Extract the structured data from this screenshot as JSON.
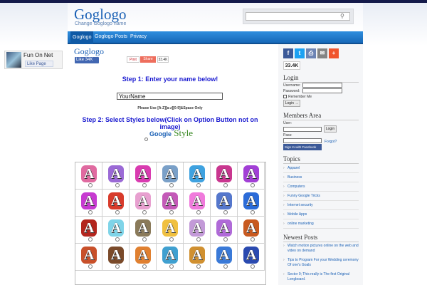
{
  "site": {
    "title": "Goglogo",
    "description": "Change Goglogo name"
  },
  "search": {
    "placeholder": ""
  },
  "nav": {
    "items": [
      "Goglogo",
      "Goglogo Posts",
      "Privacy"
    ]
  },
  "left_widget": {
    "name": "Fun On Net",
    "like_label": "Like Page"
  },
  "post": {
    "title": "Goglogo",
    "fb_like": "Like 34K",
    "pin_label": "Pinit",
    "share_label": "Share",
    "share_count": "33.4K",
    "step1": "Step 1: Enter your name below!",
    "name_value": "YourName",
    "use_note": "Please Use [A-Z][a-z][0-9]&Space Only",
    "step2": "Step 2: Select Styles below(Click on Option Button not on image)",
    "style_sample_prefix": "Google",
    "style_sample_suffix": "Style"
  },
  "style_grid": {
    "glyph": "A",
    "rows": [
      [
        "#e06aa0",
        "#9b6ad6",
        "#d93bb0",
        "#7aa0c8",
        "#3fa2e0",
        "#c9368f",
        "#a23fd6"
      ],
      [
        "#c73bd1",
        "#d83b2b",
        "#e8a0d0",
        "#c45ab8",
        "#f07adc",
        "#5577cc",
        "#2b6bd8"
      ],
      [
        "#b3261e",
        "#7fd4e8",
        "#8a7a5a",
        "#f0c040",
        "#c39ad8",
        "#b06ad8",
        "#c85a20"
      ],
      [
        "#c8502a",
        "#7a4a2a",
        "#e08030",
        "#40a0d0",
        "#d09030",
        "#3a7ad8",
        "#2a4ab0"
      ]
    ]
  },
  "social": {
    "buttons": [
      {
        "icon": "facebook-icon",
        "glyph": "f",
        "color": "#3b5998"
      },
      {
        "icon": "twitter-icon",
        "glyph": "t",
        "color": "#1da1f2"
      },
      {
        "icon": "print-icon",
        "glyph": "⎙",
        "color": "#6d84b4"
      },
      {
        "icon": "email-icon",
        "glyph": "✉",
        "color": "#848484"
      },
      {
        "icon": "more-icon",
        "glyph": "+",
        "color": "#f0552e"
      }
    ],
    "count": "33.4K"
  },
  "login": {
    "heading": "Login",
    "username_label": "Username:",
    "password_label": "Password:",
    "remember_label": "Remember Me",
    "button": "Login →"
  },
  "members": {
    "heading": "Members Area",
    "user_label": "User:",
    "pass_label": "Pass:",
    "login_button": "Login",
    "forgot": "Forgot?",
    "fb_signin": "Sign In with Facebook"
  },
  "topics": {
    "heading": "Topics",
    "items": [
      "Apparel",
      "Business",
      "Computers",
      "Funny Google Tricks",
      "Internet security",
      "Mobile Apps",
      "online marketing"
    ]
  },
  "newest": {
    "heading": "Newest Posts",
    "items": [
      "Watch motion pictures online on the web and video on demand",
      "Tips to Program For your Wedding ceremony Of one's Goals",
      "Sector 9; This really is The first Original Longboard."
    ]
  },
  "colors": {
    "accent": "#1a60b5",
    "nav": "#1668b8",
    "step": "#1a1ad0"
  }
}
